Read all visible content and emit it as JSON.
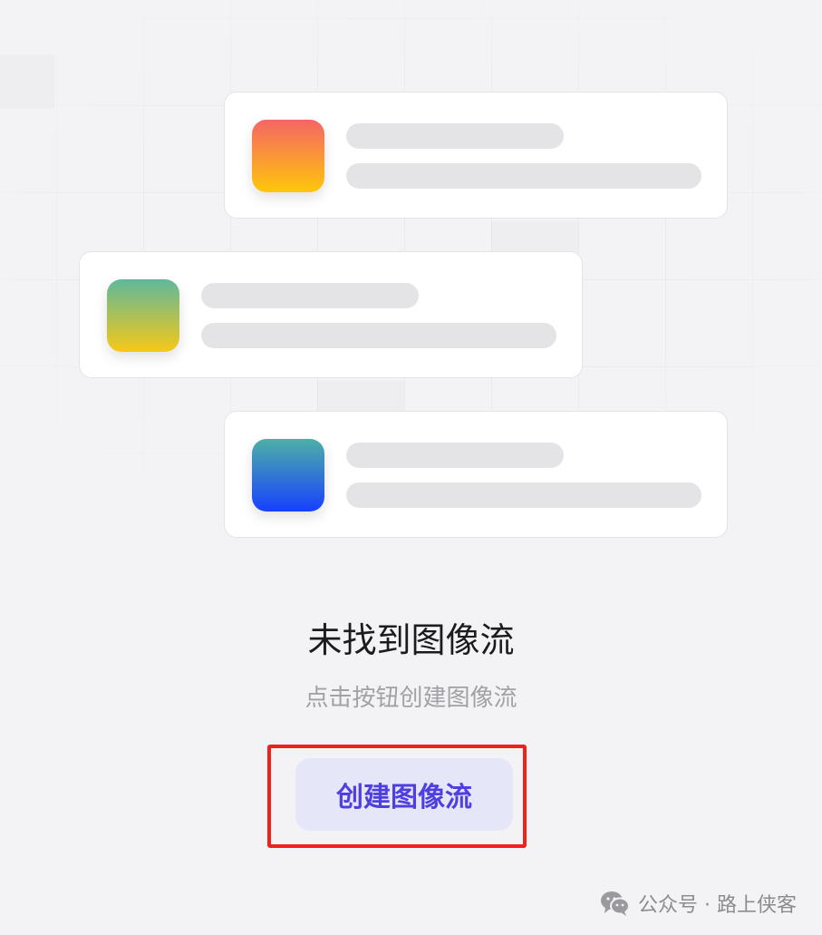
{
  "empty_state": {
    "title": "未找到图像流",
    "subtitle": "点击按钮创建图像流",
    "button_label": "创建图像流"
  },
  "watermark": {
    "text": "公众号 · 路上侠客",
    "icon": "wechat-icon"
  },
  "illustration": {
    "cards": [
      {
        "icon_gradient": [
          "#f56565",
          "#ffc70a"
        ]
      },
      {
        "icon_gradient": [
          "#5fb89b",
          "#f6c818"
        ]
      },
      {
        "icon_gradient": [
          "#4db0a6",
          "#1740ff"
        ]
      }
    ],
    "placeholder_color": "#e4e4e7"
  },
  "colors": {
    "button_bg": "#e6e6f9",
    "button_text": "#4f3fe0",
    "highlight": "#f0211d"
  }
}
